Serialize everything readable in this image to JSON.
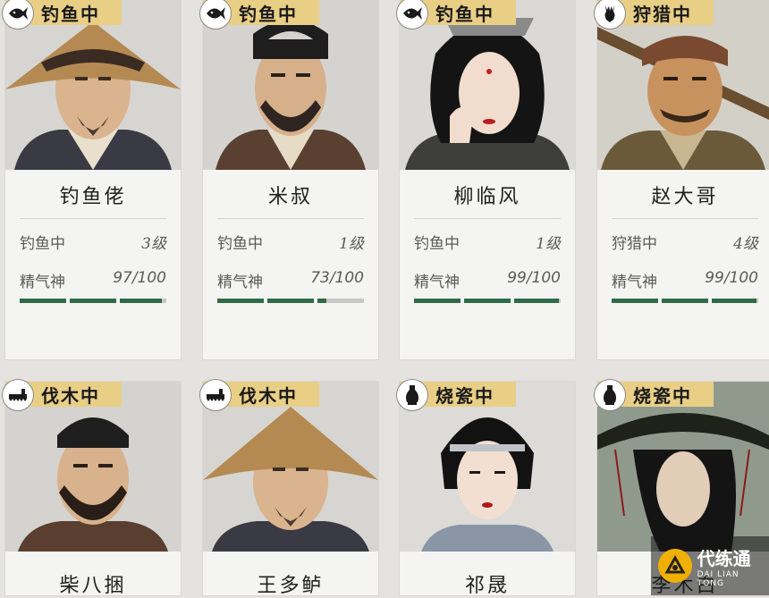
{
  "cards": [
    {
      "status": "钓鱼中",
      "icon": "fish-icon",
      "name": "钓鱼佬",
      "task_label": "钓鱼中",
      "level": "3级",
      "energy_label": "精气神",
      "energy": "97/100",
      "energy_value": 97
    },
    {
      "status": "钓鱼中",
      "icon": "fish-icon",
      "name": "米叔",
      "task_label": "钓鱼中",
      "level": "1级",
      "energy_label": "精气神",
      "energy": "73/100",
      "energy_value": 73
    },
    {
      "status": "钓鱼中",
      "icon": "fish-icon",
      "name": "柳临风",
      "task_label": "钓鱼中",
      "level": "1级",
      "energy_label": "精气神",
      "energy": "99/100",
      "energy_value": 99
    },
    {
      "status": "狩猎中",
      "icon": "deer-icon",
      "name": "赵大哥",
      "task_label": "狩猎中",
      "level": "4级",
      "energy_label": "精气神",
      "energy": "99/100",
      "energy_value": 99
    },
    {
      "status": "伐木中",
      "icon": "saw-icon",
      "name": "柴八捆"
    },
    {
      "status": "伐木中",
      "icon": "saw-icon",
      "name": "王多鲈"
    },
    {
      "status": "烧瓷中",
      "icon": "vase-icon",
      "name": "祁晟"
    },
    {
      "status": "烧瓷中",
      "icon": "vase-icon",
      "name": "李木白"
    }
  ],
  "watermark": {
    "logo": "daliantong-logo",
    "name": "代练通",
    "sub": "DAI LIAN TONG"
  }
}
